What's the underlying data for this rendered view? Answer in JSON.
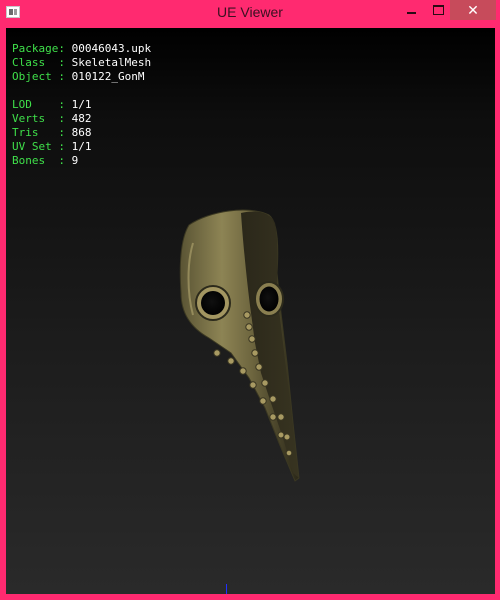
{
  "window": {
    "title": "UE Viewer",
    "icon": "app-icon",
    "controls": {
      "minimize_icon": "minimize-icon",
      "maximize_icon": "maximize-icon",
      "close_glyph": "✕"
    }
  },
  "info": {
    "package_key": "Package:",
    "package_val": "00046043.upk",
    "class_key": "Class  :",
    "class_val": "SkeletalMesh",
    "object_key": "Object :",
    "object_val": "010122_GonM",
    "lod_key": "LOD    :",
    "lod_val": "1/1",
    "verts_key": "Verts  :",
    "verts_val": "482",
    "tris_key": "Tris   :",
    "tris_val": "868",
    "uvset_key": "UV Set :",
    "uvset_val": "1/1",
    "bones_key": "Bones  :",
    "bones_val": "9"
  },
  "colors": {
    "titlebar": "#ff2a70",
    "close_button": "#c74b5b",
    "info_key": "#3fe04a",
    "info_value": "#ffffff"
  }
}
